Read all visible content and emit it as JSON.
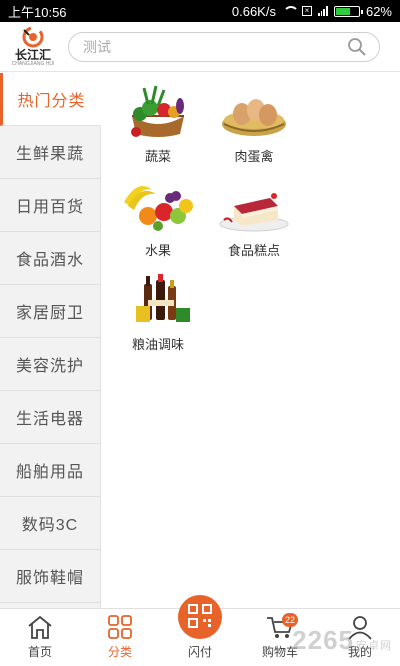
{
  "status_bar": {
    "time": "上午10:56",
    "network_speed": "0.66K/s",
    "battery": "62%",
    "battery_level": 0.62
  },
  "header": {
    "logo_name": "长江汇",
    "logo_sub": "CHANGJIANG HUI",
    "search_placeholder": "测试"
  },
  "sidebar": {
    "items": [
      {
        "label": "热门分类",
        "active": true
      },
      {
        "label": "生鲜果蔬"
      },
      {
        "label": "日用百货"
      },
      {
        "label": "食品酒水"
      },
      {
        "label": "家居厨卫"
      },
      {
        "label": "美容洗护"
      },
      {
        "label": "生活电器"
      },
      {
        "label": "船舶用品"
      },
      {
        "label": "数码3C"
      },
      {
        "label": "服饰鞋帽"
      }
    ]
  },
  "categories": [
    {
      "label": "蔬菜",
      "icon": "vegetables-image"
    },
    {
      "label": "肉蛋禽",
      "icon": "eggs-image"
    },
    {
      "label": "水果",
      "icon": "fruits-image"
    },
    {
      "label": "食品糕点",
      "icon": "cake-image"
    },
    {
      "label": "粮油调味",
      "icon": "condiments-image"
    }
  ],
  "bottom_nav": {
    "items": [
      {
        "label": "首页",
        "icon": "home-icon"
      },
      {
        "label": "分类",
        "icon": "category-icon",
        "active": true
      },
      {
        "label": "闪付",
        "icon": "qr-pay-icon"
      },
      {
        "label": "购物车",
        "icon": "cart-icon",
        "badge": "22"
      },
      {
        "label": "我的",
        "icon": "user-icon"
      }
    ]
  },
  "watermark": {
    "text": "2265",
    "sub": "安卓网"
  },
  "colors": {
    "accent": "#e8632a",
    "sidebar_bg": "#f2f2f2"
  }
}
